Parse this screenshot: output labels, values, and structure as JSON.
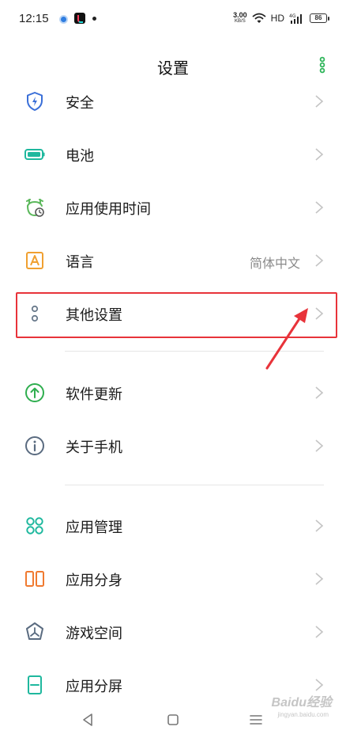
{
  "status_bar": {
    "time": "12:15",
    "net_speed_value": "3.00",
    "net_speed_unit": "KB/S",
    "hd_label": "HD",
    "battery_level": "86",
    "icons": [
      "app-notification-icon",
      "tiktok-icon",
      "wifi-icon",
      "signal-4g-icon",
      "battery-icon"
    ]
  },
  "header": {
    "title": "设置",
    "more_icon": "more-vertical-icon"
  },
  "settings": {
    "items": [
      {
        "label": "安全",
        "icon": "shield-icon",
        "color": "#3a6fd8"
      },
      {
        "label": "电池",
        "icon": "battery-icon",
        "color": "#1fb89e"
      },
      {
        "label": "应用使用时间",
        "icon": "alarm-clock-icon",
        "color": "#5cb85c"
      },
      {
        "label": "语言",
        "value": "简体中文",
        "icon": "language-a-icon",
        "color": "#f0a030"
      },
      {
        "label": "其他设置",
        "icon": "more-dots-icon",
        "color": "#6a7a8c"
      },
      {
        "label": "软件更新",
        "icon": "upgrade-arrow-icon",
        "color": "#2fae4f"
      },
      {
        "label": "关于手机",
        "icon": "info-icon",
        "color": "#5a6b80"
      },
      {
        "label": "应用管理",
        "icon": "app-grid-icon",
        "color": "#1fb89e"
      },
      {
        "label": "应用分身",
        "icon": "app-clone-icon",
        "color": "#f07a30"
      },
      {
        "label": "游戏空间",
        "icon": "game-star-icon",
        "color": "#5a6b80"
      },
      {
        "label": "应用分屏",
        "icon": "split-screen-icon",
        "color": "#1fb89e"
      }
    ]
  },
  "annotation": {
    "highlight_color": "#e8333a",
    "highlighted_item": "其他设置"
  },
  "watermark": {
    "text": "Baidu经验",
    "sub": "jingyan.baidu.com"
  }
}
